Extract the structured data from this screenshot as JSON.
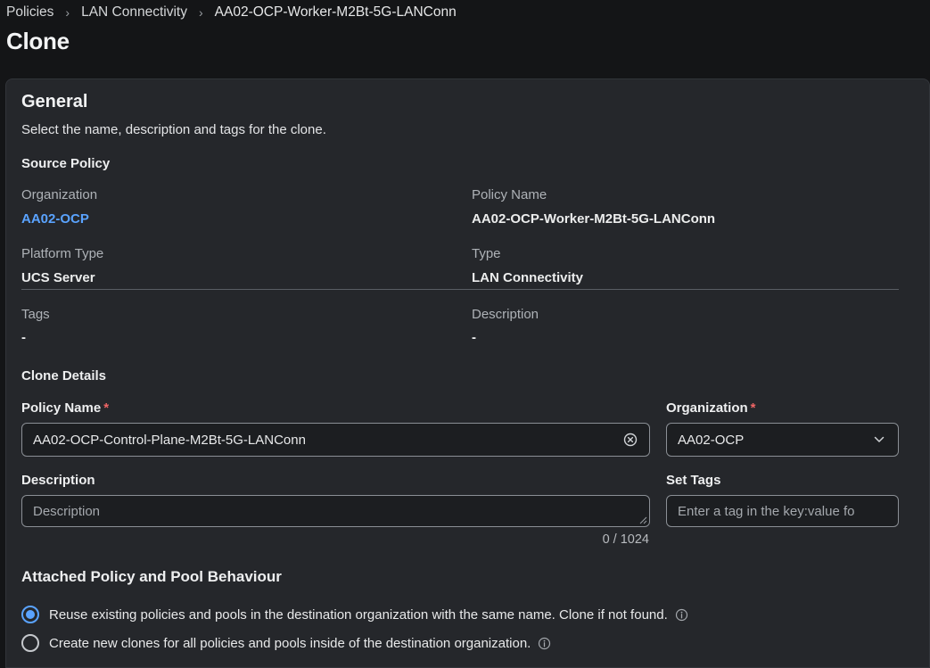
{
  "breadcrumb": [
    "Policies",
    "LAN Connectivity",
    "AA02-OCP-Worker-M2Bt-5G-LANConn"
  ],
  "page_title": "Clone",
  "general": {
    "heading": "General",
    "subtitle": "Select the name, description and tags for the clone."
  },
  "source_policy": {
    "heading": "Source Policy",
    "organization_label": "Organization",
    "organization_value": "AA02-OCP",
    "policy_name_label": "Policy Name",
    "policy_name_value": "AA02-OCP-Worker-M2Bt-5G-LANConn",
    "platform_type_label": "Platform Type",
    "platform_type_value": "UCS Server",
    "type_label": "Type",
    "type_value": "LAN Connectivity",
    "tags_label": "Tags",
    "tags_value": "-",
    "description_label": "Description",
    "description_value": "-"
  },
  "clone_details": {
    "heading": "Clone Details",
    "policy_name_label": "Policy Name",
    "policy_name_value": "AA02-OCP-Control-Plane-M2Bt-5G-LANConn",
    "organization_label": "Organization",
    "organization_value": "AA02-OCP",
    "description_label": "Description",
    "description_placeholder": "Description",
    "description_counter": "0 / 1024",
    "set_tags_label": "Set Tags",
    "set_tags_placeholder": "Enter a tag in the key:value fo",
    "required_marker": "*"
  },
  "behaviour": {
    "heading": "Attached Policy and Pool Behaviour",
    "option_reuse": "Reuse existing policies and pools in the destination organization with the same name. Clone if not found.",
    "option_create": "Create new clones for all policies and pools inside of the destination organization.",
    "selected": "reuse"
  },
  "colors": {
    "accent": "#5aa3ff",
    "required": "#f06565",
    "card_bg": "#25272b",
    "page_bg": "#141517"
  },
  "icons": {
    "clear": "clear-circle-icon",
    "dropdown": "chevron-down-icon",
    "info": "info-icon",
    "breadcrumb_separator": "chevron-right-icon"
  }
}
